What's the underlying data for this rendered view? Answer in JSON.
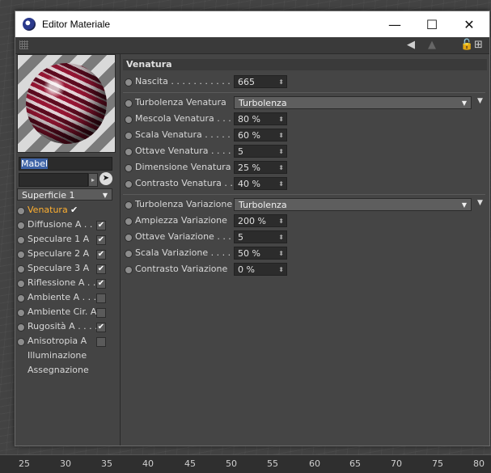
{
  "window": {
    "title": "Editor Materiale",
    "minimize": "—",
    "maximize": "☐",
    "close": "✕"
  },
  "timeline": {
    "ticks": [
      "25",
      "30",
      "35",
      "40",
      "45",
      "50",
      "55",
      "60",
      "65",
      "70",
      "75",
      "80"
    ]
  },
  "left_panel": {
    "material_name": "Mabel",
    "surface_dropdown": "Superficie 1",
    "channels": [
      {
        "label": "Venatura",
        "active": true,
        "checked": true
      },
      {
        "label": "Diffusione A . .",
        "checked": true
      },
      {
        "label": "Speculare 1 A",
        "checked": true
      },
      {
        "label": "Speculare 2 A",
        "checked": true
      },
      {
        "label": "Speculare 3 A",
        "checked": true
      },
      {
        "label": "Riflessione A . .",
        "checked": true
      },
      {
        "label": "Ambiente A . . . .",
        "checked": false
      },
      {
        "label": "Ambiente Cir. A",
        "checked": false
      },
      {
        "label": "Rugosità A . . . .",
        "checked": true
      },
      {
        "label": "Anisotropia A",
        "checked": false
      },
      {
        "label": "Illuminazione"
      },
      {
        "label": "Assegnazione"
      }
    ]
  },
  "section": {
    "title": "Venatura"
  },
  "params": {
    "nascita": {
      "label": "Nascita . . . . . . . . . . . . .",
      "value": "665"
    },
    "turb_venatura": {
      "label": "Turbolenza Venatura",
      "value": "Turbolenza"
    },
    "mescola": {
      "label": "Mescola Venatura . . . .",
      "value": "80 %"
    },
    "scala": {
      "label": "Scala Venatura  . . . . . .",
      "value": "60 %"
    },
    "ottave": {
      "label": "Ottave Venatura . . . . .",
      "value": "5"
    },
    "dimensione": {
      "label": "Dimensione Venatura",
      "value": "25 %"
    },
    "contrasto": {
      "label": "Contrasto Venatura . .",
      "value": "40 %"
    },
    "turb_variazione": {
      "label": "Turbolenza Variazione",
      "value": "Turbolenza"
    },
    "ampiezza_var": {
      "label": "Ampiezza Variazione",
      "value": "200 %"
    },
    "ottave_var": {
      "label": "Ottave Variazione . . . .",
      "value": "5"
    },
    "scala_var": {
      "label": "Scala Variazione . . . . .",
      "value": "50 %"
    },
    "contrasto_var": {
      "label": "Contrasto Variazione",
      "value": "0 %"
    }
  },
  "icons": {
    "spin": "⬍",
    "dropdown_arrow": "▼",
    "checkmark": "✔",
    "expand": "▼"
  }
}
